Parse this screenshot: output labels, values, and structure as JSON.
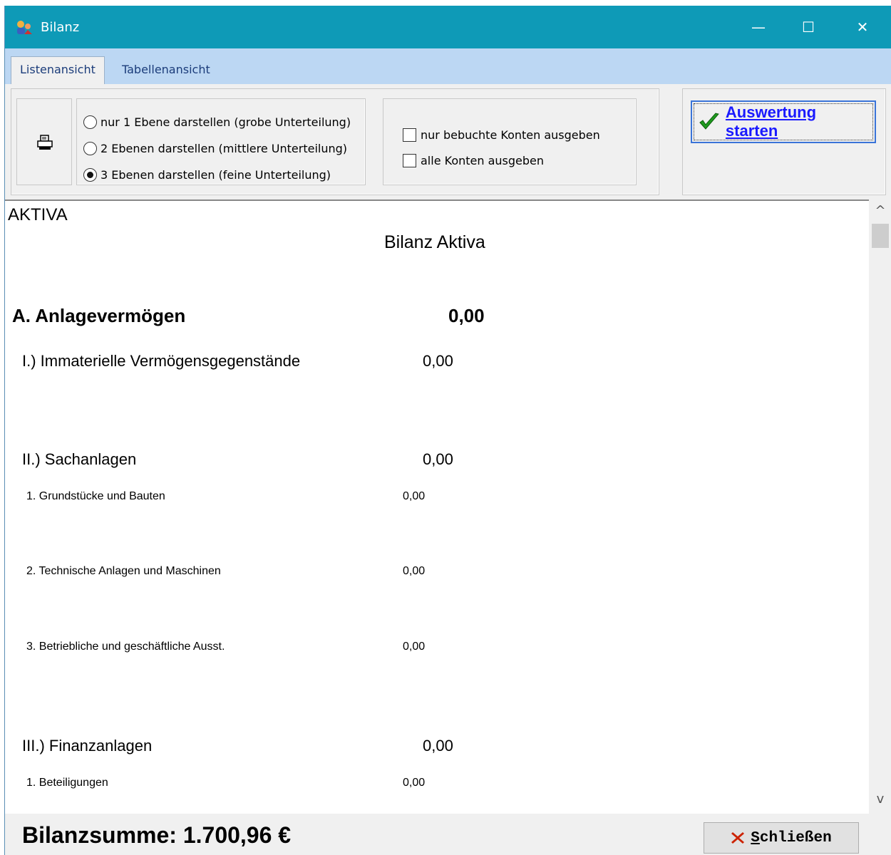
{
  "window": {
    "title": "Bilanz",
    "minimize_glyph": "—",
    "maximize_glyph": "☐",
    "close_glyph": "✕"
  },
  "tabs": [
    {
      "label": "Listenansicht",
      "active": true
    },
    {
      "label": "Tabellenansicht",
      "active": false
    }
  ],
  "toolbar": {
    "print_icon": "printer-icon",
    "levels": [
      {
        "label": "nur 1 Ebene darstellen (grobe Unterteilung)",
        "checked": false
      },
      {
        "label": "2 Ebenen darstellen (mittlere Unterteilung)",
        "checked": false
      },
      {
        "label": "3 Ebenen darstellen (feine Unterteilung)",
        "checked": true
      }
    ],
    "options": [
      {
        "label": "nur bebuchte Konten ausgeben",
        "checked": false
      },
      {
        "label": "alle Konten ausgeben",
        "checked": false
      }
    ],
    "start_button": {
      "label": "Auswertung starten",
      "icon": "checkmark-icon"
    }
  },
  "report": {
    "section": "AKTIVA",
    "heading": "Bilanz Aktiva",
    "group": {
      "label": "A. Anlagevermögen",
      "value": "0,00"
    },
    "sub1": {
      "label": "I.) Immaterielle Vermögensgegenstände",
      "value": "0,00"
    },
    "sub2": {
      "label": "II.) Sachanlagen",
      "value": "0,00"
    },
    "sub2_items": [
      {
        "label": "1. Grundstücke und Bauten",
        "value": "0,00"
      },
      {
        "label": "2. Technische Anlagen und Maschinen",
        "value": "0,00"
      },
      {
        "label": "3. Betriebliche und geschäftliche Ausst.",
        "value": "0,00"
      }
    ],
    "sub3": {
      "label": "III.) Finanzanlagen",
      "value": "0,00"
    },
    "sub3_items": [
      {
        "label": "1. Beteiligungen",
        "value": "0,00"
      }
    ]
  },
  "scroll": {
    "up_glyph": "^",
    "down_glyph": "v"
  },
  "footer": {
    "summary": "Bilanzsumme:  1.700,96 €",
    "close_button": {
      "label_underlined": "S",
      "label_rest": "chließen",
      "icon": "red-x-icon"
    }
  },
  "colors": {
    "titlebar": "#0e9ab7",
    "tabbar": "#bcd7f3",
    "start_label": "#1a1aff",
    "close_x": "#cc2200"
  }
}
